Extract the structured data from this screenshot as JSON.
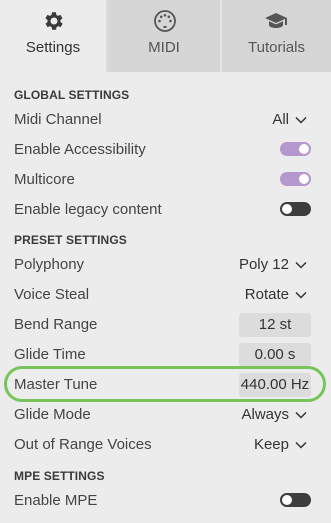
{
  "tabs": [
    {
      "label": "Settings",
      "icon": "gear-icon",
      "active": true
    },
    {
      "label": "MIDI",
      "icon": "midi-connector-icon",
      "active": false
    },
    {
      "label": "Tutorials",
      "icon": "graduation-cap-icon",
      "active": false
    }
  ],
  "global": {
    "header": "GLOBAL SETTINGS",
    "midi_channel": {
      "label": "Midi Channel",
      "value": "All"
    },
    "accessibility": {
      "label": "Enable Accessibility",
      "on": true
    },
    "multicore": {
      "label": "Multicore",
      "on": true
    },
    "legacy": {
      "label": "Enable legacy content",
      "on": false
    }
  },
  "preset": {
    "header": "PRESET SETTINGS",
    "polyphony": {
      "label": "Polyphony",
      "value": "Poly 12"
    },
    "voice_steal": {
      "label": "Voice Steal",
      "value": "Rotate"
    },
    "bend_range": {
      "label": "Bend Range",
      "value": "12 st"
    },
    "glide_time": {
      "label": "Glide Time",
      "value": "0.00 s"
    },
    "master_tune": {
      "label": "Master Tune",
      "value": "440.00 Hz"
    },
    "glide_mode": {
      "label": "Glide Mode",
      "value": "Always"
    },
    "out_of_range": {
      "label": "Out of Range Voices",
      "value": "Keep"
    }
  },
  "mpe": {
    "header": "MPE SETTINGS",
    "enable": {
      "label": "Enable MPE",
      "on": false
    }
  },
  "colors": {
    "toggle_on": "#b596cf",
    "toggle_off": "#3d3d3d",
    "highlight": "#77c45b",
    "background": "#ececec"
  }
}
